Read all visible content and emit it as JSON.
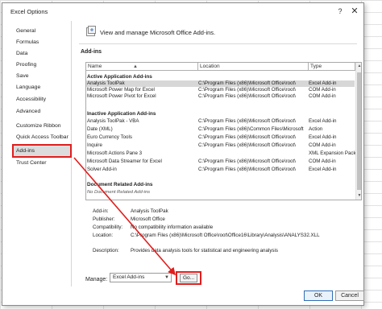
{
  "window": {
    "title": "Excel Options",
    "help_icon": "?",
    "close_icon": "✕"
  },
  "nav": {
    "items": [
      {
        "label": "General"
      },
      {
        "label": "Formulas"
      },
      {
        "label": "Data"
      },
      {
        "label": "Proofing"
      },
      {
        "label": "Save"
      },
      {
        "label": "Language"
      },
      {
        "label": "Accessibility"
      },
      {
        "label": "Advanced"
      },
      {
        "label": "Customize Ribbon"
      },
      {
        "label": "Quick Access Toolbar"
      },
      {
        "label": "Add-ins"
      },
      {
        "label": "Trust Center"
      }
    ],
    "selected": "Add-ins"
  },
  "main": {
    "heading": "View and manage Microsoft Office Add-ins.",
    "section_title": "Add-ins",
    "columns": [
      "Name",
      "Location",
      "Type"
    ],
    "sort_indicator": "▲",
    "groups": [
      {
        "title": "Active Application Add-ins",
        "rows": [
          {
            "name": "Analysis ToolPak",
            "location": "C:\\Program Files (x86)\\Microsoft Office\\root\\",
            "type": "Excel Add-in",
            "selected": true
          },
          {
            "name": "Microsoft Power Map for Excel",
            "location": "C:\\Program Files (x86)\\Microsoft Office\\root\\",
            "type": "COM Add-in"
          },
          {
            "name": "Microsoft Power Pivot for Excel",
            "location": "C:\\Program Files (x86)\\Microsoft Office\\root\\",
            "type": "COM Add-in"
          }
        ]
      },
      {
        "title": "Inactive Application Add-ins",
        "rows": [
          {
            "name": "Analysis ToolPak - VBA",
            "location": "C:\\Program Files (x86)\\Microsoft Office\\root\\",
            "type": "Excel Add-in"
          },
          {
            "name": "Date (XML)",
            "location": "C:\\Program Files (x86)\\Common Files\\Microsoft",
            "type": "Action"
          },
          {
            "name": "Euro Currency Tools",
            "location": "C:\\Program Files (x86)\\Microsoft Office\\root\\",
            "type": "Excel Add-in"
          },
          {
            "name": "Inquire",
            "location": "C:\\Program Files (x86)\\Microsoft Office\\root\\",
            "type": "COM Add-in"
          },
          {
            "name": "Microsoft Actions Pane 3",
            "location": "",
            "type": "XML Expansion Pack"
          },
          {
            "name": "Microsoft Data Streamer for Excel",
            "location": "C:\\Program Files (x86)\\Microsoft Office\\root\\",
            "type": "COM Add-in"
          },
          {
            "name": "Solver Add-in",
            "location": "C:\\Program Files (x86)\\Microsoft Office\\root\\",
            "type": "Excel Add-in"
          }
        ]
      },
      {
        "title": "Document Related Add-ins",
        "subtext": "No Document Related Add-ins"
      }
    ],
    "details": [
      {
        "label": "Add-in:",
        "value": "Analysis ToolPak"
      },
      {
        "label": "Publisher:",
        "value": "Microsoft Office"
      },
      {
        "label": "Compatibility:",
        "value": "No compatibility information available"
      },
      {
        "label": "Location:",
        "value": "C:\\Program Files (x86)\\Microsoft Office\\root\\Office16\\Library\\Analysis\\ANALYS32.XLL"
      },
      {
        "label": "Description:",
        "value": "Provides data analysis tools for statistical and engineering analysis"
      }
    ],
    "manage_label": "Manage:",
    "manage_value": "Excel Add-ins",
    "go_label": "Go..."
  },
  "footer": {
    "ok_label": "OK",
    "cancel_label": "Cancel"
  },
  "colors": {
    "highlight": "#e01e1e",
    "selection": "#d7d7d7"
  },
  "icons": [
    "question-icon",
    "close-icon",
    "addins-icon",
    "sort-up-icon",
    "dropdown-caret-icon",
    "scroll-up-icon",
    "scroll-down-icon"
  ]
}
